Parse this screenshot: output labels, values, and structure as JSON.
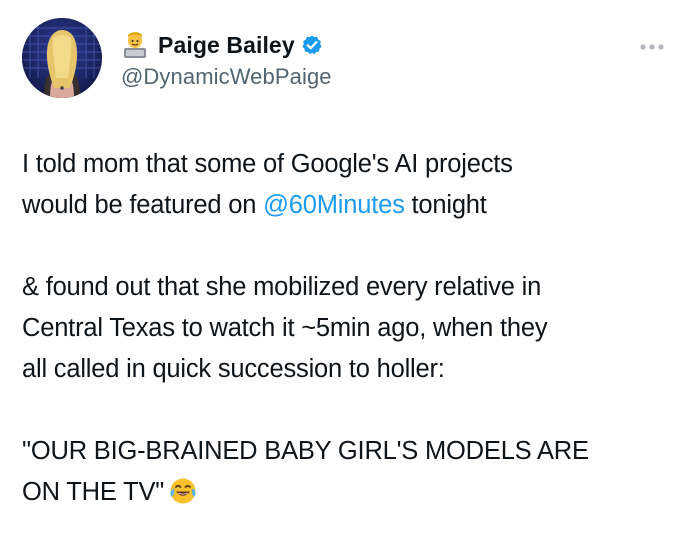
{
  "author": {
    "display_name": "Paige Bailey",
    "handle": "@DynamicWebPaige",
    "name_emoji": "technologist-emoji",
    "verified": true
  },
  "more_menu": {
    "icon": "more-dots-icon"
  },
  "tweet": {
    "line1_pre": "I told mom that some of Google's AI projects",
    "line2_pre": "would be featured on ",
    "mention": "@60Minutes",
    "line2_post": " tonight",
    "para2_line1": "& found out that she mobilized every relative in",
    "para2_line2": "Central Texas to watch it ~5min ago, when they",
    "para2_line3": "all called in quick succession to holler:",
    "para3_line1": "\"OUR BIG-BRAINED BABY GIRL'S MODELS ARE",
    "para3_line2": "ON THE TV\"",
    "end_emoji": "tears-of-joy-emoji"
  },
  "colors": {
    "text": "#0f1419",
    "secondary": "#536471",
    "link": "#1d9bf0",
    "verified": "#1d9bf0"
  }
}
